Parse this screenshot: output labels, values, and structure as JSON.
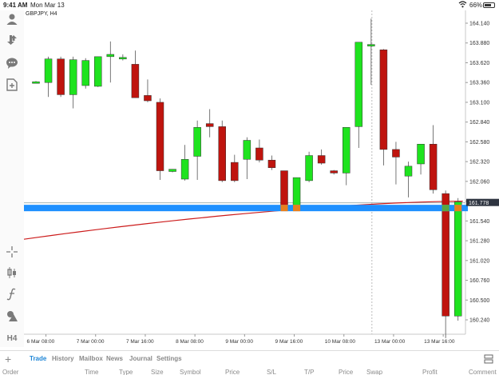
{
  "status_bar": {
    "time": "9:41 AM",
    "date": "Mon Mar 13",
    "battery": "66%"
  },
  "chart": {
    "symbol": "GBPJPY, H4",
    "price_labels": [
      "164.140",
      "163.880",
      "163.620",
      "163.360",
      "163.100",
      "162.840",
      "162.580",
      "162.320",
      "162.060",
      "161.800",
      "161.540",
      "161.280",
      "161.020",
      "160.760",
      "160.500",
      "160.240"
    ],
    "current_price": "161.778",
    "time_labels": [
      "6 Mar 08:00",
      "7 Mar 00:00",
      "7 Mar 16:00",
      "8 Mar 08:00",
      "9 Mar 00:00",
      "9 Mar 16:00",
      "10 Mar 08:00",
      "13 Mar 00:00",
      "13 Mar 16:00",
      "14 Mar 08:00"
    ],
    "colors": {
      "bull": "#1ee31e",
      "bear": "#bf140e",
      "position_line": "#1e90ff",
      "ma": "#cc1b1b",
      "stop_marker": "#e8801e",
      "take_marker": "#57a843"
    }
  },
  "chart_data": {
    "type": "candlestick",
    "title": "GBPJPY, H4",
    "ylim": [
      160.1,
      164.3
    ],
    "candles": [
      {
        "o": 163.36,
        "h": 163.38,
        "l": 163.35,
        "c": 163.37
      },
      {
        "o": 163.36,
        "h": 163.7,
        "l": 163.17,
        "c": 163.67
      },
      {
        "o": 163.67,
        "h": 163.7,
        "l": 163.17,
        "c": 163.2
      },
      {
        "o": 163.2,
        "h": 163.7,
        "l": 163.02,
        "c": 163.66
      },
      {
        "o": 163.32,
        "h": 163.68,
        "l": 163.28,
        "c": 163.65
      },
      {
        "o": 163.31,
        "h": 163.68,
        "l": 163.3,
        "c": 163.7
      },
      {
        "o": 163.7,
        "h": 163.9,
        "l": 163.36,
        "c": 163.73
      },
      {
        "o": 163.67,
        "h": 163.73,
        "l": 163.65,
        "c": 163.69
      },
      {
        "o": 163.6,
        "h": 163.78,
        "l": 163.19,
        "c": 163.16
      },
      {
        "o": 163.19,
        "h": 163.4,
        "l": 163.1,
        "c": 163.12
      },
      {
        "o": 163.1,
        "h": 163.15,
        "l": 162.08,
        "c": 162.2
      },
      {
        "o": 162.19,
        "h": 162.21,
        "l": 162.18,
        "c": 162.22
      },
      {
        "o": 162.09,
        "h": 162.54,
        "l": 162.07,
        "c": 162.35
      },
      {
        "o": 162.39,
        "h": 162.86,
        "l": 162.08,
        "c": 162.77
      },
      {
        "o": 162.82,
        "h": 163.01,
        "l": 162.64,
        "c": 162.78
      },
      {
        "o": 162.78,
        "h": 162.86,
        "l": 162.05,
        "c": 162.07
      },
      {
        "o": 162.31,
        "h": 162.41,
        "l": 162.05,
        "c": 162.07
      },
      {
        "o": 162.35,
        "h": 162.64,
        "l": 162.09,
        "c": 162.6
      },
      {
        "o": 162.5,
        "h": 162.61,
        "l": 162.31,
        "c": 162.34
      },
      {
        "o": 162.34,
        "h": 162.4,
        "l": 162.21,
        "c": 162.24
      },
      {
        "o": 162.2,
        "h": 162.2,
        "l": 161.73,
        "c": 161.73
      },
      {
        "o": 161.73,
        "h": 162.08,
        "l": 161.71,
        "c": 162.11
      },
      {
        "o": 162.07,
        "h": 162.45,
        "l": 162.05,
        "c": 162.4
      },
      {
        "o": 162.4,
        "h": 162.48,
        "l": 162.28,
        "c": 162.3
      },
      {
        "o": 162.2,
        "h": 162.21,
        "l": 162.15,
        "c": 162.17
      },
      {
        "o": 162.17,
        "h": 162.73,
        "l": 162.01,
        "c": 162.77
      },
      {
        "o": 162.78,
        "h": 163.8,
        "l": 162.5,
        "c": 163.89
      },
      {
        "o": 163.85,
        "h": 164.2,
        "l": 163.33,
        "c": 163.86
      },
      {
        "o": 163.79,
        "h": 163.8,
        "l": 162.27,
        "c": 162.48
      },
      {
        "o": 162.48,
        "h": 162.58,
        "l": 162.02,
        "c": 162.38
      },
      {
        "o": 162.13,
        "h": 162.32,
        "l": 161.85,
        "c": 162.26
      },
      {
        "o": 162.29,
        "h": 162.54,
        "l": 162.15,
        "c": 162.55
      },
      {
        "o": 162.55,
        "h": 162.8,
        "l": 161.9,
        "c": 161.95
      },
      {
        "o": 161.9,
        "h": 161.94,
        "l": 160.0,
        "c": 160.29
      },
      {
        "o": 160.29,
        "h": 161.84,
        "l": 160.23,
        "c": 161.79
      }
    ]
  },
  "bottom_tabs": [
    "Trade",
    "History",
    "Mailbox",
    "News",
    "Journal",
    "Settings"
  ],
  "columns": [
    "Order",
    "Time",
    "Type",
    "Size",
    "Symbol",
    "Price",
    "S/L",
    "T/P",
    "Price",
    "Swap",
    "Profit",
    "Comment"
  ],
  "icons": [
    "person-icon",
    "arrows-icon",
    "chat-icon",
    "new-order-icon",
    "crosshair-icon",
    "candles-icon",
    "function-icon",
    "objects-icon"
  ],
  "timeframe": "H4"
}
